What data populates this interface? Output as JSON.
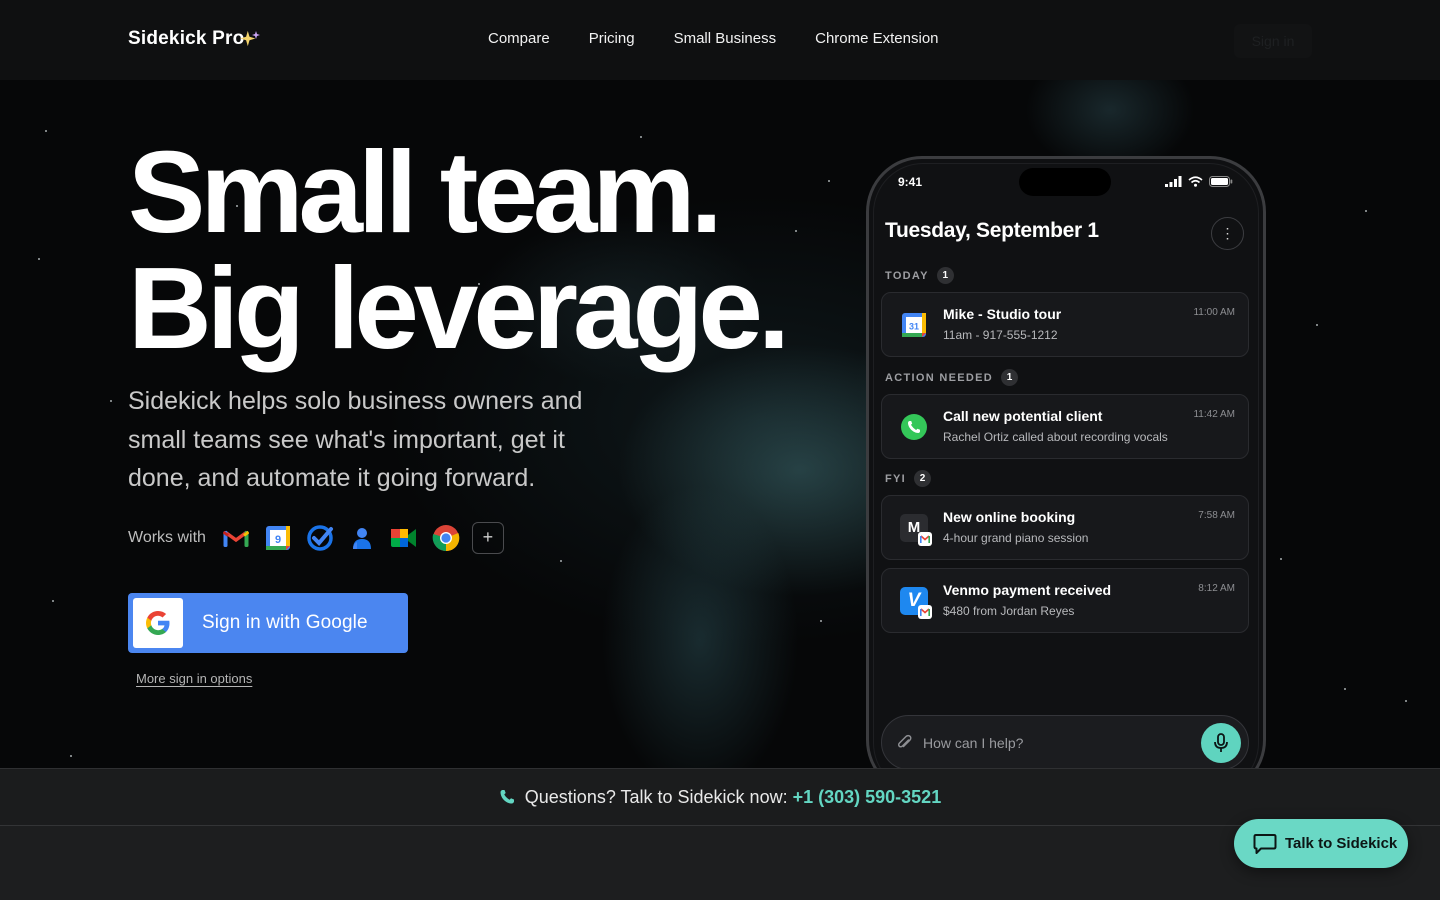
{
  "header": {
    "logo": "Sidekick Pro",
    "nav": [
      "Compare",
      "Pricing",
      "Small Business",
      "Chrome Extension"
    ],
    "sign_in": "Sign in"
  },
  "hero": {
    "headline_line1": "Small team.",
    "headline_line2": "Big leverage.",
    "subtext": "Sidekick helps solo business owners and small teams see what's important, get it done, and automate it going forward.",
    "works_with_label": "Works with",
    "integrations": [
      "gmail-icon",
      "google-calendar-icon",
      "google-tasks-icon",
      "google-contacts-icon",
      "google-meet-icon",
      "chrome-icon"
    ],
    "plus": "+",
    "google_button": "Sign in with Google",
    "more_options": "More sign in options"
  },
  "phone": {
    "time": "9:41",
    "date": "Tuesday, September 1",
    "more": "⋮",
    "sections": [
      {
        "label": "TODAY",
        "count": "1"
      },
      {
        "label": "ACTION NEEDED",
        "count": "1"
      },
      {
        "label": "FYI",
        "count": "2"
      }
    ],
    "cards": [
      {
        "title": "Mike - Studio tour",
        "subtitle": "11am - 917-555-1212",
        "time": "11:00 AM",
        "icon": "google-calendar-icon"
      },
      {
        "title": "Call new potential client",
        "subtitle": "Rachel Ortiz called about recording vocals",
        "time": "11:42 AM",
        "icon": "phone-icon"
      },
      {
        "title": "New online booking",
        "subtitle": "4-hour grand piano session",
        "time": "7:58 AM",
        "icon": "m-letter-icon",
        "letter": "M"
      },
      {
        "title": "Venmo payment received",
        "subtitle": "$480 from Jordan Reyes",
        "time": "8:12 AM",
        "icon": "venmo-icon",
        "letter": "V"
      }
    ],
    "ask_placeholder": "How can I help?"
  },
  "bottom_bar": {
    "text": "Questions? Talk to Sidekick now:",
    "phone": "+1 (303) 590-3521"
  },
  "talk_button": "Talk to Sidekick",
  "colors": {
    "accent": "#63d6c2",
    "google_blue": "#4b86f0"
  }
}
